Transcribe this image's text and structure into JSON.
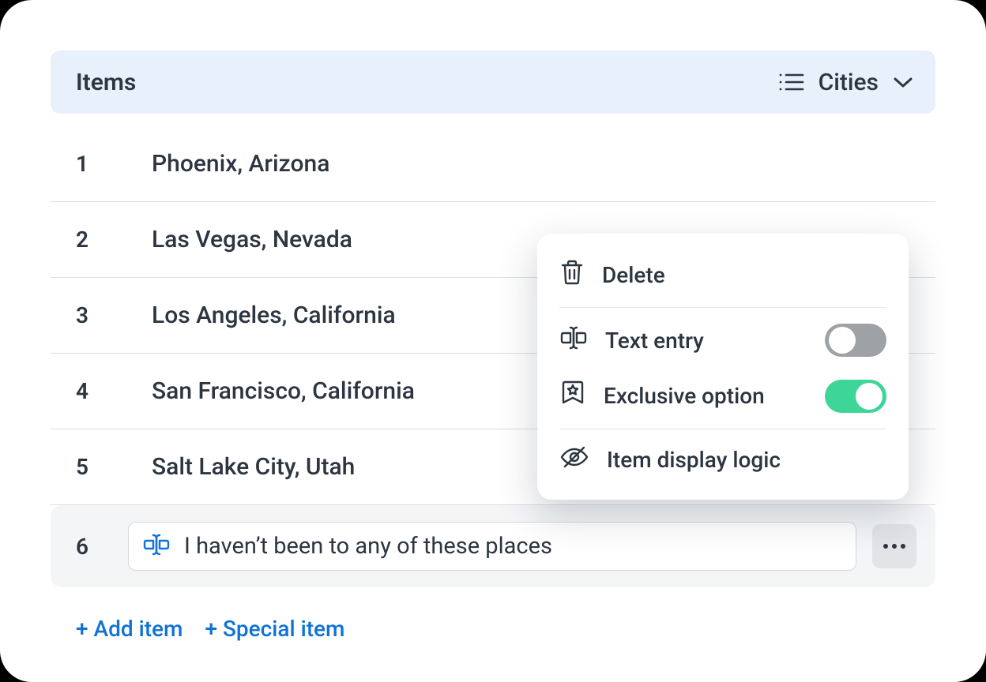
{
  "header": {
    "title": "Items",
    "selector_label": "Cities"
  },
  "items": [
    {
      "num": "1",
      "label": "Phoenix, Arizona"
    },
    {
      "num": "2",
      "label": "Las Vegas, Nevada"
    },
    {
      "num": "3",
      "label": "Los Angeles, California"
    },
    {
      "num": "4",
      "label": "San Francisco, California"
    },
    {
      "num": "5",
      "label": "Salt Lake City, Utah"
    }
  ],
  "editing": {
    "num": "6",
    "value": "I haven’t been to any of these places"
  },
  "footer": {
    "add_item": "+ Add item",
    "special_item": "+ Special item"
  },
  "popover": {
    "delete": "Delete",
    "text_entry": "Text entry",
    "text_entry_on": false,
    "exclusive_option": "Exclusive option",
    "exclusive_option_on": true,
    "item_display_logic": "Item display logic"
  }
}
